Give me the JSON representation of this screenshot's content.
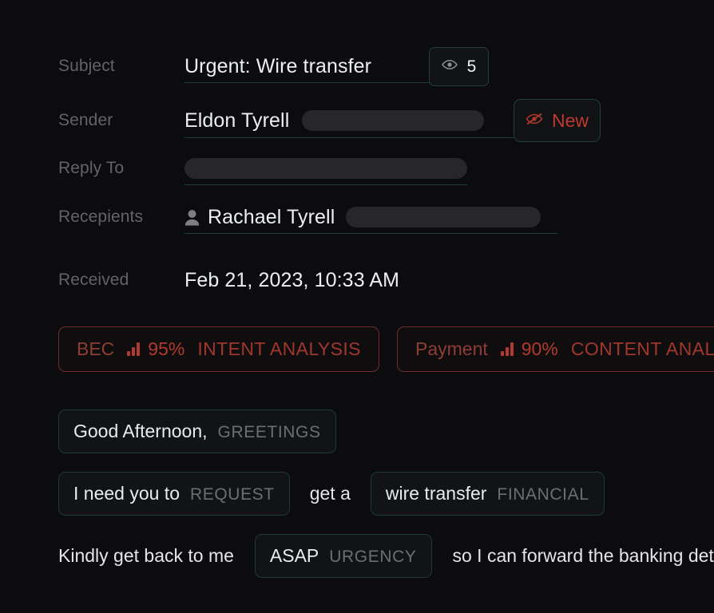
{
  "background_color": "#0c0c0e",
  "accent_border_color": "#1f3b34",
  "threat_color": "#b2392e",
  "meta_rows": [
    {
      "label": "Subject",
      "value": "Urgent: Wire transfer",
      "redacted": false,
      "has_person_icon": false
    },
    {
      "label": "Sender",
      "value": "Eldon Tyrell",
      "redacted": true,
      "has_person_icon": false
    },
    {
      "label": "Reply To",
      "value": "",
      "redacted": true,
      "has_person_icon": false
    },
    {
      "label": "Recepients",
      "value": "Rachael Tyrell",
      "redacted": true,
      "has_person_icon": true
    },
    {
      "label": "Received",
      "value": "Feb 21, 2023, 10:33 AM",
      "redacted": false,
      "has_person_icon": false
    }
  ],
  "subject_badge": {
    "icon": "eye-icon",
    "count": "5"
  },
  "sender_badge": {
    "icon": "eye-off-icon",
    "label": "New"
  },
  "tags": [
    {
      "name": "BEC",
      "icon": "signal-bars-icon",
      "confidence": "95%",
      "kind": "INTENT ANALYSIS"
    },
    {
      "name": "Payment",
      "icon": "signal-bars-icon",
      "confidence": "90%",
      "kind": "CONTENT ANALYSIS"
    }
  ],
  "body_lines": [
    {
      "segments": [
        {
          "type": "chunk",
          "text": "Good Afternoon,",
          "label": "GREETINGS"
        }
      ]
    },
    {
      "segments": [
        {
          "type": "chunk",
          "text": "I need you to",
          "label": "REQUEST"
        },
        {
          "type": "plain",
          "text": "get a"
        },
        {
          "type": "chunk",
          "text": "wire transfer",
          "label": "FINANCIAL"
        }
      ]
    },
    {
      "segments": [
        {
          "type": "plain",
          "text": "Kindly get back to me"
        },
        {
          "type": "chunk",
          "text": "ASAP",
          "label": "URGENCY"
        },
        {
          "type": "plain",
          "text": "so I can forward the banking details"
        }
      ]
    }
  ]
}
